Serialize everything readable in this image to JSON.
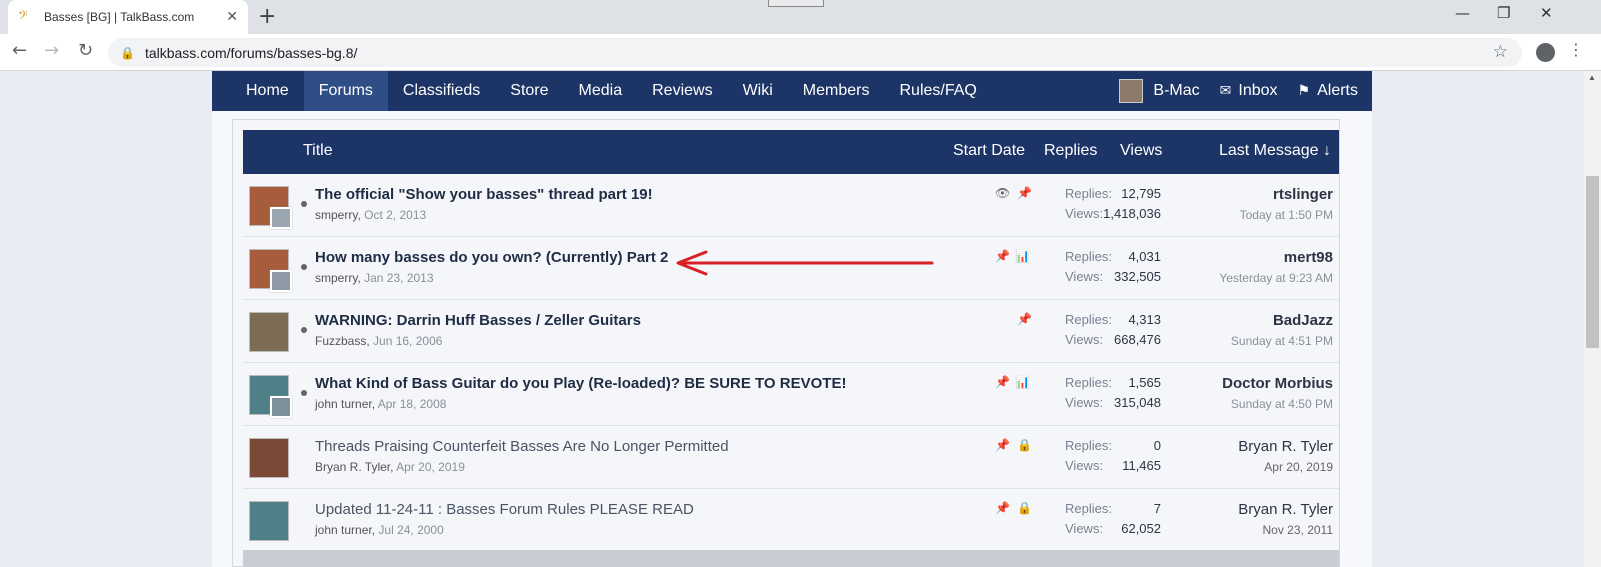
{
  "browser": {
    "tab_title": "Basses [BG] | TalkBass.com",
    "tab_icon": "bass-clef-icon",
    "url": "talkbass.com/forums/basses-bg.8/"
  },
  "nav": {
    "items": [
      "Home",
      "Forums",
      "Classifieds",
      "Store",
      "Media",
      "Reviews",
      "Wiki",
      "Members",
      "Rules/FAQ"
    ],
    "active": "Forums",
    "user": "B-Mac",
    "inbox": "Inbox",
    "alerts": "Alerts"
  },
  "list_header": {
    "title": "Title",
    "start_date": "Start Date",
    "replies": "Replies",
    "views": "Views",
    "last_message": "Last Message ↓"
  },
  "labels": {
    "replies": "Replies:",
    "views": "Views:"
  },
  "threads": [
    {
      "title": "The official \"Show your basses\" thread part 19!",
      "author": "smperry",
      "date": "Oct 2, 2013",
      "replies": "12,795",
      "views": "1,418,036",
      "last_user": "rtslinger",
      "last_time": "Today at 1:50 PM",
      "icons": [
        "eye-icon",
        "pin-icon"
      ],
      "unread": true
    },
    {
      "title": "How many basses do you own? (Currently) Part 2",
      "author": "smperry",
      "date": "Jan 23, 2013",
      "replies": "4,031",
      "views": "332,505",
      "last_user": "mert98",
      "last_time": "Yesterday at 9:23 AM",
      "icons": [
        "pin-icon",
        "poll-icon"
      ],
      "unread": true
    },
    {
      "title": "WARNING: Darrin Huff Basses / Zeller Guitars",
      "author": "Fuzzbass",
      "date": "Jun 16, 2006",
      "replies": "4,313",
      "views": "668,476",
      "last_user": "BadJazz",
      "last_time": "Sunday at 4:51 PM",
      "icons": [
        "pin-icon"
      ],
      "unread": true
    },
    {
      "title": "What Kind of Bass Guitar do you Play (Re-loaded)? BE SURE TO REVOTE!",
      "author": "john turner",
      "date": "Apr 18, 2008",
      "replies": "1,565",
      "views": "315,048",
      "last_user": "Doctor Morbius",
      "last_time": "Sunday at 4:50 PM",
      "icons": [
        "pin-icon",
        "poll-icon"
      ],
      "unread": true
    },
    {
      "title": "Threads Praising Counterfeit Basses Are No Longer Permitted",
      "author": "Bryan R. Tyler",
      "date": "Apr 20, 2019",
      "replies": "0",
      "views": "11,465",
      "last_user": "Bryan R. Tyler",
      "last_time": "Apr 20, 2019",
      "icons": [
        "pin-icon",
        "lock-icon"
      ],
      "unread": false
    },
    {
      "title": "Updated 11-24-11 : Basses Forum Rules PLEASE READ",
      "author": "john turner",
      "date": "Jul 24, 2000",
      "replies": "7",
      "views": "62,052",
      "last_user": "Bryan R. Tyler",
      "last_time": "Nov 23, 2011",
      "icons": [
        "pin-icon",
        "lock-icon"
      ],
      "unread": false
    }
  ],
  "colors": {
    "nav_bg": "#1c3466",
    "nav_active": "#2f4d86",
    "annotation_arrow": "#d92027"
  }
}
